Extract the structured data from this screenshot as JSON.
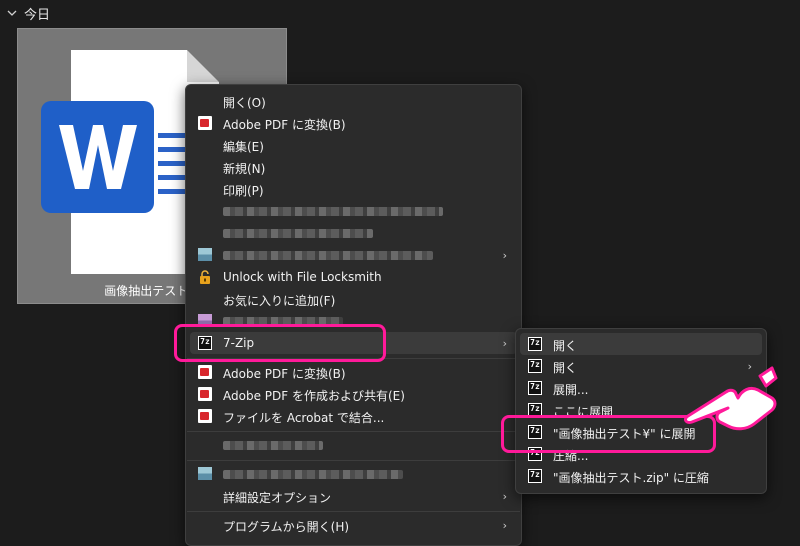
{
  "group": {
    "title": "今日"
  },
  "file": {
    "label": "画像抽出テスト.d"
  },
  "context_menu": {
    "open": "開く(O)",
    "adobe_convert": "Adobe PDF に変換(B)",
    "edit": "編集(E)",
    "new": "新規(N)",
    "print": "印刷(P)",
    "unlock": "Unlock with File Locksmith",
    "add_favorite": "お気に入りに追加(F)",
    "seven_zip": "7-Zip",
    "adobe_convert2": "Adobe PDF に変換(B)",
    "adobe_create_share": "Adobe PDF を作成および共有(E)",
    "acrobat_combine": "ファイルを Acrobat で結合...",
    "advanced_options": "詳細設定オプション",
    "open_with": "プログラムから開く(H)"
  },
  "submenu_7zip": {
    "open": "開く",
    "open_sub": "開く",
    "extract": "展開...",
    "extract_here": "ここに展開",
    "extract_to": "\"画像抽出テスト¥\" に展開",
    "compress": "圧縮...",
    "compress_zip": "\"画像抽出テスト.zip\" に圧縮"
  },
  "icons": {
    "seven_zip_glyph": "7z",
    "highlight_color": "#ff1a9a"
  }
}
